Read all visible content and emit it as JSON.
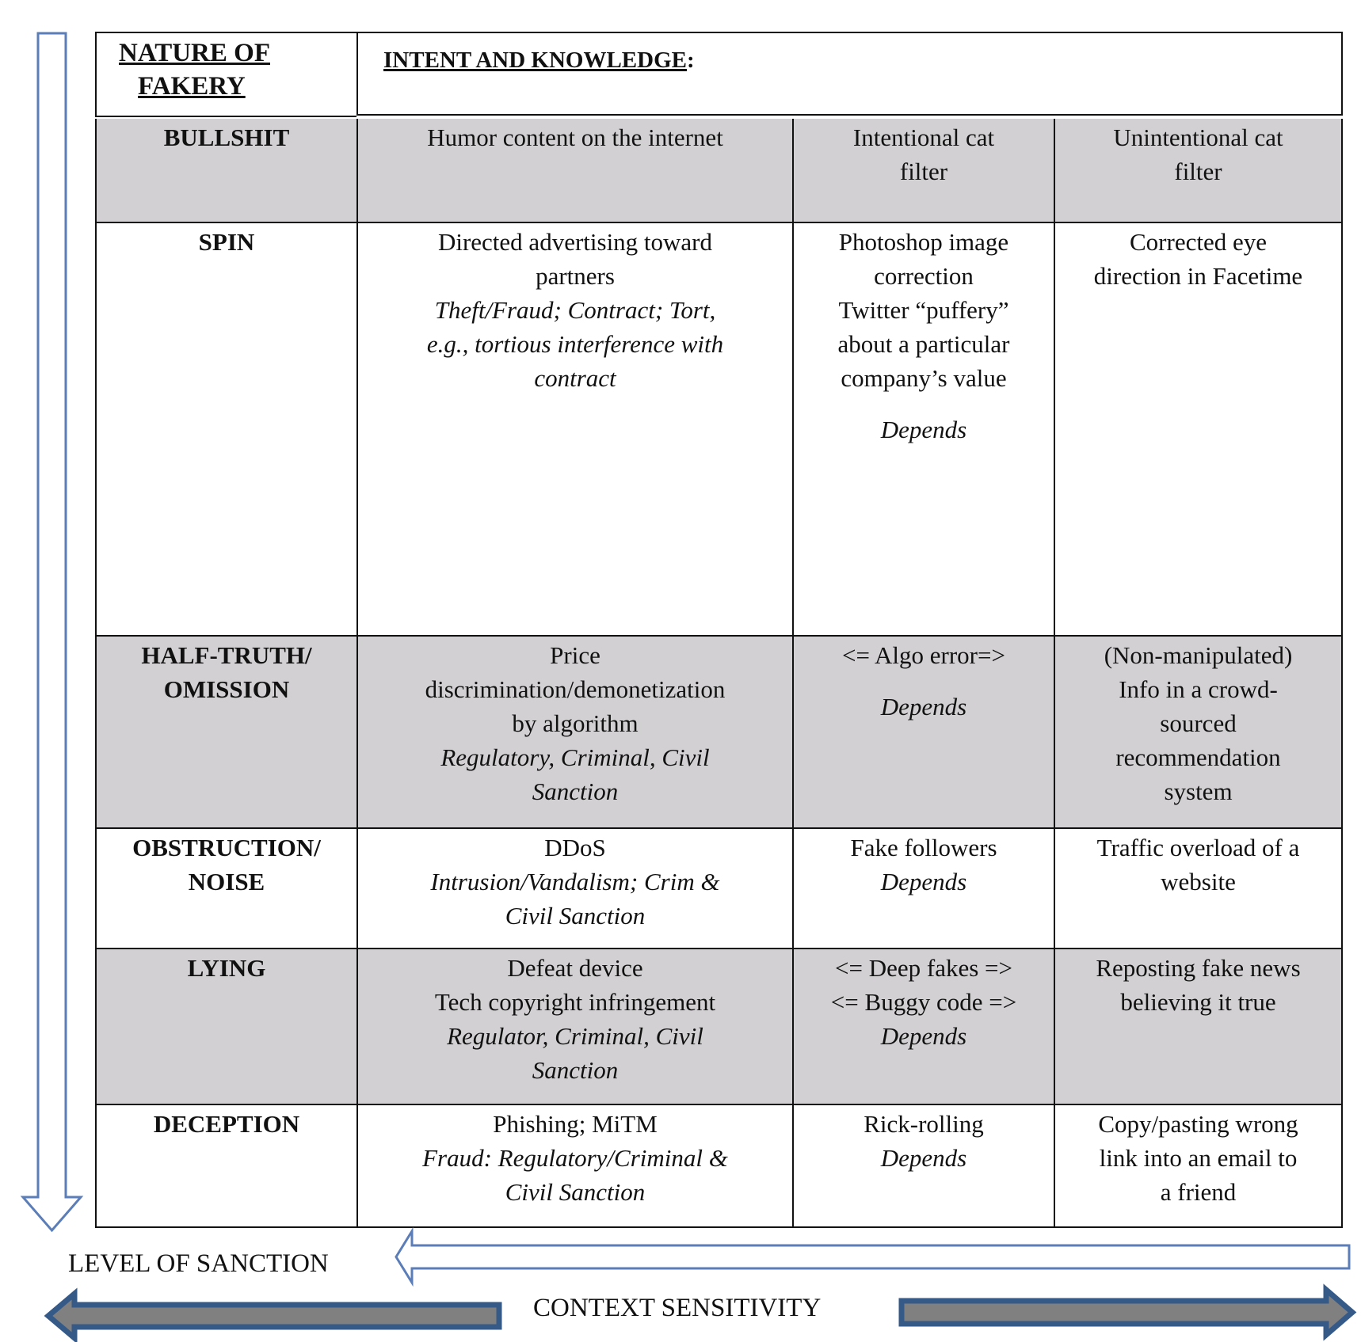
{
  "header": {
    "nature_title_lines": [
      "NATURE OF",
      "FAKERY"
    ],
    "intent_title": "INTENT AND KNOWLEDGE",
    "intent_suffix": ":"
  },
  "rows": [
    {
      "category": [
        "BULLSHIT"
      ],
      "shade": "gray",
      "cells": [
        {
          "lines": [
            {
              "t": "Humor content on the internet",
              "i": false
            }
          ]
        },
        {
          "lines": [
            {
              "t": "Intentional cat",
              "i": false
            },
            {
              "t": "filter",
              "i": false
            }
          ]
        },
        {
          "lines": [
            {
              "t": "Unintentional cat",
              "i": false
            },
            {
              "t": "filter",
              "i": false
            }
          ]
        }
      ]
    },
    {
      "category": [
        "SPIN"
      ],
      "shade": "white",
      "cells": [
        {
          "lines": [
            {
              "t": "Directed advertising toward",
              "i": false
            },
            {
              "t": "partners",
              "i": false
            },
            {
              "t": "Theft/Fraud; Contract; Tort,",
              "i": true
            },
            {
              "t": "e.g., tortious interference with",
              "i": true
            },
            {
              "t": "contract",
              "i": true
            }
          ]
        },
        {
          "lines": [
            {
              "t": "Photoshop image",
              "i": false
            },
            {
              "t": "correction",
              "i": false
            },
            {
              "t": "Twitter “puffery”",
              "i": false
            },
            {
              "t": "about a particular",
              "i": false
            },
            {
              "t": "company’s value",
              "i": false
            },
            {
              "t": "",
              "gap": true
            },
            {
              "t": "Depends",
              "i": true
            }
          ]
        },
        {
          "lines": [
            {
              "t": "Corrected eye",
              "i": false
            },
            {
              "t": "direction in Facetime",
              "i": false
            }
          ]
        }
      ]
    },
    {
      "category": [
        "HALF-TRUTH/",
        "OMISSION"
      ],
      "shade": "gray",
      "cells": [
        {
          "lines": [
            {
              "t": "Price",
              "i": false
            },
            {
              "t": "discrimination/demonetization",
              "i": false
            },
            {
              "t": "by algorithm",
              "i": false
            },
            {
              "t": "Regulatory, Criminal, Civil",
              "i": true
            },
            {
              "t": "Sanction",
              "i": true
            }
          ]
        },
        {
          "lines": [
            {
              "t": "<= Algo error=>",
              "i": false
            },
            {
              "t": "",
              "gap": true
            },
            {
              "t": "Depends",
              "i": true
            }
          ]
        },
        {
          "lines": [
            {
              "t": "(Non-manipulated)",
              "i": false
            },
            {
              "t": "Info in a crowd-",
              "i": false
            },
            {
              "t": "sourced",
              "i": false
            },
            {
              "t": "recommendation",
              "i": false
            },
            {
              "t": "system",
              "i": false
            }
          ]
        }
      ]
    },
    {
      "category": [
        "OBSTRUCTION/",
        "NOISE"
      ],
      "shade": "white",
      "cells": [
        {
          "lines": [
            {
              "t": "DDoS",
              "i": false
            },
            {
              "t": "Intrusion/Vandalism; Crim &",
              "i": true
            },
            {
              "t": "Civil Sanction",
              "i": true
            }
          ]
        },
        {
          "lines": [
            {
              "t": "Fake followers",
              "i": false
            },
            {
              "t": "Depends",
              "i": true
            }
          ]
        },
        {
          "lines": [
            {
              "t": "Traffic overload of a",
              "i": false
            },
            {
              "t": "website",
              "i": false
            }
          ]
        }
      ]
    },
    {
      "category": [
        "LYING"
      ],
      "shade": "gray",
      "cells": [
        {
          "lines": [
            {
              "t": "Defeat device",
              "i": false
            },
            {
              "t": "Tech copyright infringement",
              "i": false
            },
            {
              "t": "Regulator, Criminal, Civil",
              "i": true
            },
            {
              "t": "Sanction",
              "i": true
            }
          ]
        },
        {
          "lines": [
            {
              "t": "<= Deep fakes =>",
              "i": false
            },
            {
              "t": "<= Buggy code =>",
              "i": false
            },
            {
              "t": "Depends",
              "i": true
            }
          ]
        },
        {
          "lines": [
            {
              "t": "Reposting fake news",
              "i": false
            },
            {
              "t": "believing it true",
              "i": false
            }
          ]
        }
      ]
    },
    {
      "category": [
        "DECEPTION"
      ],
      "shade": "white",
      "cells": [
        {
          "lines": [
            {
              "t": "Phishing; MiTM",
              "i": false
            },
            {
              "t": "Fraud: Regulatory/Criminal &",
              "i": true
            },
            {
              "t": "Civil Sanction",
              "i": true
            }
          ]
        },
        {
          "lines": [
            {
              "t": "Rick-rolling",
              "i": false
            },
            {
              "t": "Depends",
              "i": true
            }
          ]
        },
        {
          "lines": [
            {
              "t": "Copy/pasting wrong",
              "i": false
            },
            {
              "t": "link into an email to",
              "i": false
            },
            {
              "t": "a friend",
              "i": false
            }
          ]
        }
      ]
    }
  ],
  "axes": {
    "level_of_sanction": "LEVEL OF SANCTION",
    "context_sensitivity": "CONTEXT SENSITIVITY"
  },
  "colors": {
    "row_gray": "#d2d0d2",
    "outline_arrow": "#5b7db8",
    "solid_arrow_border": "#355a88",
    "solid_arrow_fill": "#808080"
  }
}
